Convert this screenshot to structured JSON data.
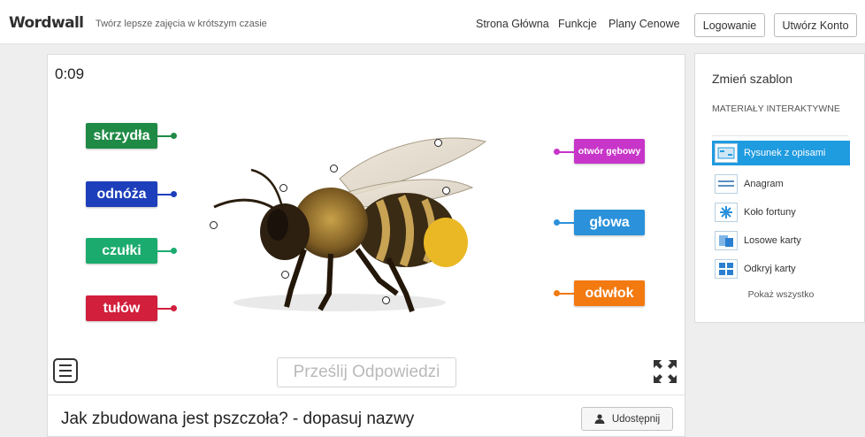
{
  "header": {
    "logo": "Wordwall",
    "tagline": "Twórz lepsze zajęcia w krótszym czasie",
    "nav": [
      "Strona Główna",
      "Funkcje",
      "Plany Cenowe"
    ],
    "login": "Logowanie",
    "signup": "Utwórz Konto"
  },
  "activity": {
    "timer": "0:09",
    "labels_left": [
      {
        "text": "skrzydła",
        "color": "#1f8a45"
      },
      {
        "text": "odnóża",
        "color": "#1d3fbb"
      },
      {
        "text": "czułki",
        "color": "#1bab6e"
      },
      {
        "text": "tułów",
        "color": "#d11f3c"
      }
    ],
    "labels_right": [
      {
        "text": "otwór gębowy",
        "color": "#c735c9"
      },
      {
        "text": "głowa",
        "color": "#2a91da"
      },
      {
        "text": "odwłok",
        "color": "#f27a10"
      }
    ],
    "submit": "Prześlij Odpowiedzi",
    "title": "Jak zbudowana jest pszczoła? - dopasuj nazwy",
    "share": "Udostępnij"
  },
  "sidebar": {
    "title": "Zmień szablon",
    "section": "MATERIAŁY INTERAKTYWNE",
    "templates": [
      {
        "label": "Rysunek z opisami",
        "icon": "labelled-diagram-icon",
        "active": true
      },
      {
        "label": "Anagram",
        "icon": "anagram-icon",
        "active": false
      },
      {
        "label": "Koło fortuny",
        "icon": "wheel-icon",
        "active": false
      },
      {
        "label": "Losowe karty",
        "icon": "random-cards-icon",
        "active": false
      },
      {
        "label": "Odkryj karty",
        "icon": "flip-tiles-icon",
        "active": false
      }
    ],
    "show_all": "Pokaż wszystko"
  }
}
